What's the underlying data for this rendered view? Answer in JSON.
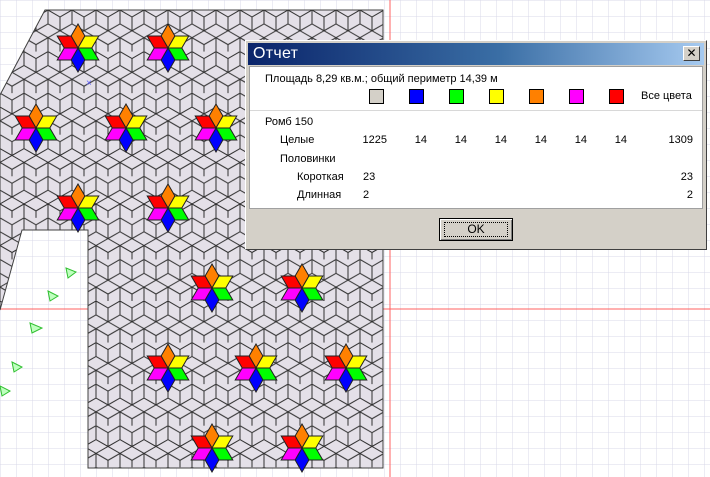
{
  "dialog": {
    "title": "Отчет",
    "close_glyph": "✕",
    "summary": "Площадь 8,29 кв.м.; общий периметр 14,39 м",
    "color_swatches": [
      "#d4d0c8",
      "#0000ff",
      "#00ff00",
      "#ffff00",
      "#ff8000",
      "#ff00ff",
      "#ff0000"
    ],
    "all_colors_label": "Все цвета",
    "tile_name": "Ромб 150",
    "rows": {
      "whole": {
        "label": "Целые",
        "values": [
          "1225",
          "14",
          "14",
          "14",
          "14",
          "14",
          "14"
        ],
        "total": "1309"
      },
      "halves_label": "Половинки",
      "short": {
        "label": "Короткая",
        "first": "23",
        "total": "23"
      },
      "long": {
        "label": "Длинная",
        "first": "2",
        "total": "2"
      }
    },
    "ok_label": "OK"
  },
  "canvas": {
    "tile_fill": "#e4e0e8",
    "grid_color": "#d8d8e8",
    "guide_color": "#ff4040",
    "flower_colors": [
      "#ff8000",
      "#ffff00",
      "#00ff00",
      "#0000ff",
      "#ff00ff",
      "#ff0000"
    ]
  }
}
